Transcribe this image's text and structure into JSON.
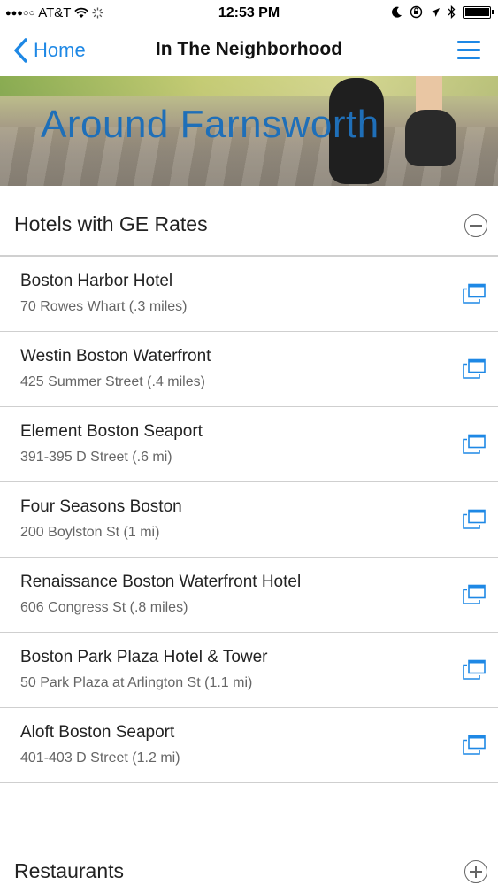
{
  "status_bar": {
    "signal": "●●●○○",
    "carrier": "AT&T",
    "time": "12:53 PM"
  },
  "navbar": {
    "back_label": "Home",
    "title": "In The Neighborhood"
  },
  "banner": {
    "title": "Around Farnsworth"
  },
  "sections": {
    "hotels": {
      "title": "Hotels with GE Rates",
      "items": [
        {
          "name": "Boston Harbor Hotel",
          "address": "70 Rowes Whart (.3 miles)"
        },
        {
          "name": "Westin Boston Waterfront",
          "address": "425 Summer Street (.4 miles)"
        },
        {
          "name": "Element Boston Seaport",
          "address": "391-395 D Street (.6 mi)"
        },
        {
          "name": "Four Seasons Boston",
          "address": "200 Boylston St (1 mi)"
        },
        {
          "name": "Renaissance Boston Waterfront Hotel",
          "address": "606 Congress St (.8 miles)"
        },
        {
          "name": "Boston Park Plaza Hotel & Tower",
          "address": "50 Park Plaza at Arlington St (1.1 mi)"
        },
        {
          "name": "Aloft Boston Seaport",
          "address": "401-403 D Street (1.2 mi)"
        }
      ]
    },
    "restaurants": {
      "title": "Restaurants"
    }
  },
  "colors": {
    "accent": "#1e88e5",
    "banner_title": "#1f6fb8",
    "divider": "#d0d0d0"
  },
  "icons": {
    "back": "chevron-left-icon",
    "menu": "hamburger-menu-icon",
    "collapse": "minus-circle-icon",
    "expand": "plus-circle-icon",
    "open_external": "open-external-icon"
  }
}
